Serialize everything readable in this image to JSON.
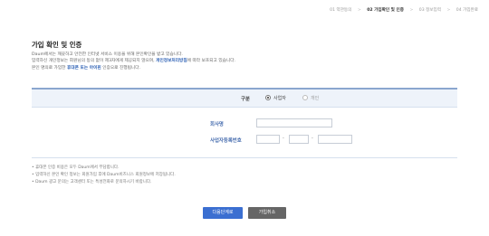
{
  "steps": {
    "items": [
      {
        "label": "01 약관동의",
        "active": false
      },
      {
        "label": "02 가입확인 및 인증",
        "active": true
      },
      {
        "label": "03 정보입력",
        "active": false
      },
      {
        "label": "04 가입완료",
        "active": false
      }
    ],
    "separator": ">"
  },
  "title": "가입 확인 및 인증",
  "description": {
    "line1": "Daum에서는 깨끗하고 안전한 인터넷 서비스 이용을 위해 본인확인을 받고 있습니다.",
    "line2_a": "입력하신 개인정보는 회원님의 동의 없이 제3자에게 제공되지 않으며, ",
    "line2_link": "개인정보처리방침",
    "line2_b": "에 따라 보호되고 있습니다.",
    "line3_a": "본인 명의로 가입한 ",
    "line3_link": "휴대폰 또는 아이핀",
    "line3_b": " 인증으로 진행됩니다."
  },
  "member_type": {
    "label": "구분",
    "options": [
      "사업자",
      "개인"
    ],
    "selected": "사업자"
  },
  "form": {
    "company_label": "회사명",
    "company_value": "",
    "bizno_label": "사업자등록번호",
    "bizno_parts": [
      "",
      "",
      ""
    ],
    "dash": "-"
  },
  "notes": [
    "• 휴대폰 인증 비용은 모두 Daum에서 부담합니다.",
    "• 입력하신 본인 확인 정보는 회원가입 후에 Daum비즈니스 회원정보에 저장됩니다.",
    "• Daum 광고 문의는 고객센터 또는 특성전화로 문의하시기 바랍니다."
  ],
  "buttons": {
    "next": "다음단계로",
    "cancel": "가입취소"
  },
  "colors": {
    "accent": "#3b6fd1",
    "label_blue": "#4a6fb0",
    "bar_bg": "#eef3fa",
    "cancel_gray": "#666666"
  }
}
